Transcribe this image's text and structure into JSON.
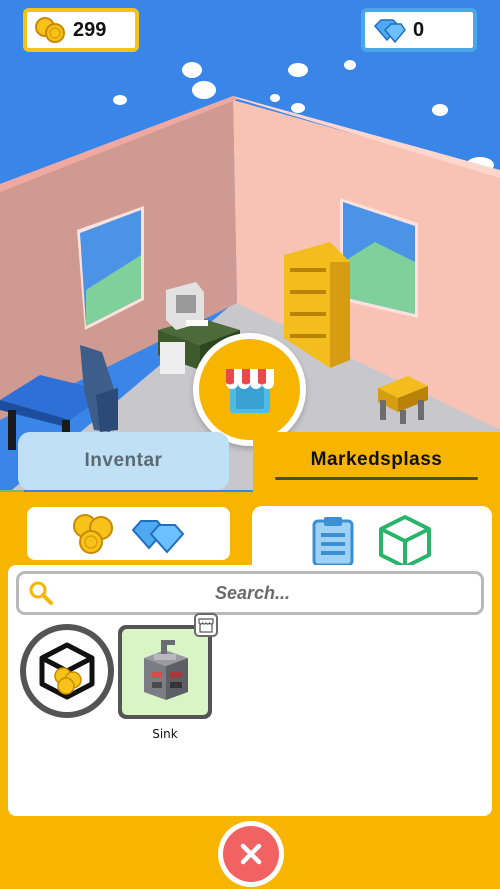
{
  "hud": {
    "coins": "299",
    "gems": "0",
    "coin_icon": "coin-stack-icon",
    "gem_icon": "gem-icon"
  },
  "shop": {
    "icon": "shop-awning-icon"
  },
  "tabs": [
    {
      "label": "Inventar",
      "active": false
    },
    {
      "label": "Markedsplass",
      "active": true
    }
  ],
  "market": {
    "currency_icons": [
      "coins-icon",
      "gems-icon"
    ],
    "category_icons": [
      "clipboard-icon",
      "cube-icon"
    ],
    "search": {
      "placeholder": "Search...",
      "value": ""
    },
    "filter_icon": "cube-coins-icon",
    "items": [
      {
        "name": "Sink",
        "icon": "sink-icon",
        "badge_icon": "shop-badge-icon"
      }
    ]
  },
  "close": {
    "icon": "close-icon"
  },
  "colors": {
    "sky": "#3a86e8",
    "panel": "#f7b500",
    "inactive_tab": "#bfe0f5",
    "close": "#f26262",
    "item_bg": "#d9f5c6"
  }
}
